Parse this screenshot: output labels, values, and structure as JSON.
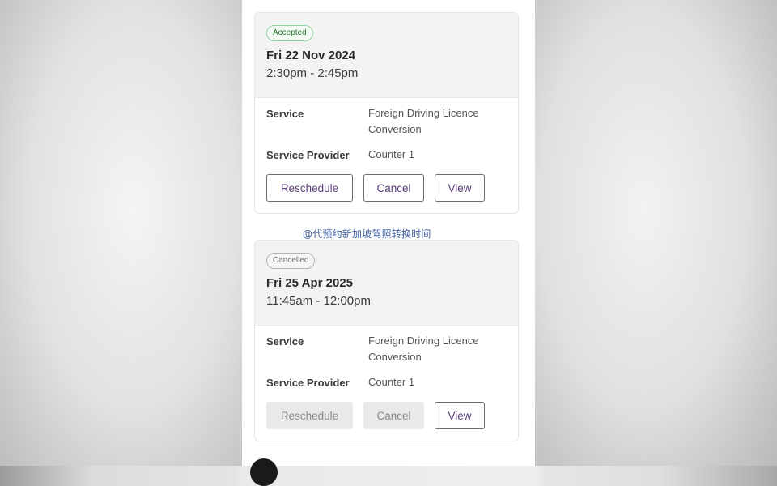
{
  "appointments": [
    {
      "status": "Accepted",
      "date": "Fri 22 Nov 2024",
      "time": "2:30pm - 2:45pm",
      "service_label": "Service",
      "service_value_line1": "Foreign Driving Licence",
      "service_value_line2": "Conversion",
      "provider_label": "Service Provider",
      "provider_value": "Counter 1",
      "buttons": {
        "reschedule": "Reschedule",
        "cancel": "Cancel",
        "view": "View"
      }
    },
    {
      "status": "Cancelled",
      "date": "Fri 25 Apr 2025",
      "time": "11:45am - 12:00pm",
      "service_label": "Service",
      "service_value_line1": "Foreign Driving Licence",
      "service_value_line2": "Conversion",
      "provider_label": "Service Provider",
      "provider_value": "Counter 1",
      "buttons": {
        "reschedule": "Reschedule",
        "cancel": "Cancel",
        "view": "View"
      }
    }
  ],
  "watermark": "@代预约新加坡驾照转换时间",
  "colors": {
    "accepted": "#2e7d32",
    "cancelled": "#6a6a6a",
    "button_text": "#5a3e7a",
    "watermark": "#3d5fa0"
  }
}
